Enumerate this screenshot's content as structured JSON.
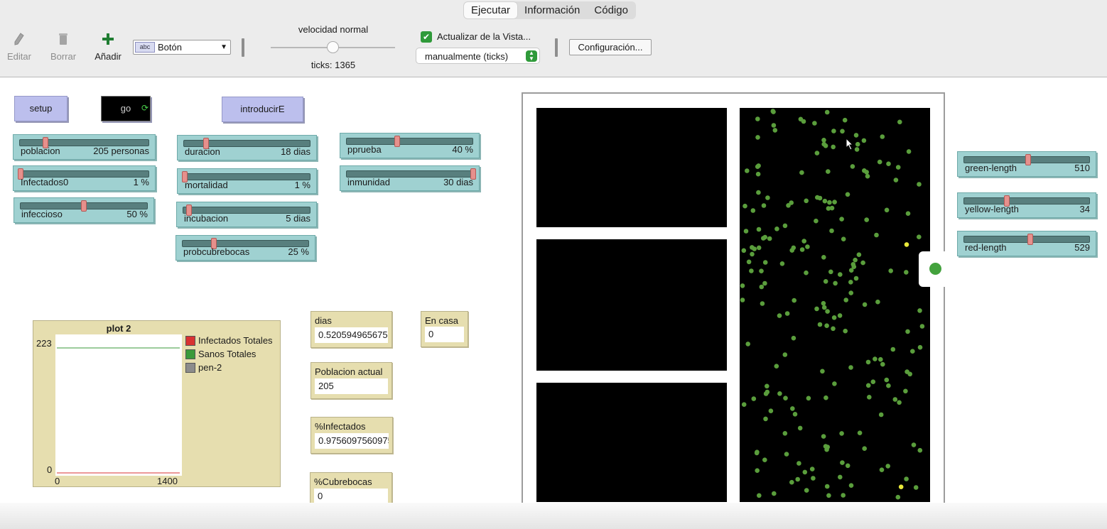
{
  "tabs": [
    "Ejecutar",
    "Información",
    "Código"
  ],
  "toolbar": {
    "edit_label": "Editar",
    "delete_label": "Borrar",
    "add_label": "Añadir",
    "widget_select": "Botón",
    "widget_select_icon_text": "abc",
    "speed_label": "velocidad normal",
    "speed_value": 0.5,
    "ticks": "ticks: 1365",
    "update_view_label": "Actualizar de la Vista...",
    "update_view_checked": true,
    "update_mode": "manualmente (ticks)",
    "settings_button": "Configuración..."
  },
  "buttons": {
    "setup": "setup",
    "go": "go",
    "introducir": "introducirE"
  },
  "sliders": {
    "poblacion": {
      "name": "poblacion",
      "value": "205 personas",
      "fraction": 0.2
    },
    "infectados0": {
      "name": "Infectados0",
      "value": "1 %",
      "fraction": 0.01
    },
    "infeccioso": {
      "name": "infeccioso",
      "value": "50 %",
      "fraction": 0.5
    },
    "duracion": {
      "name": "duracion",
      "value": "18 dias",
      "fraction": 0.18
    },
    "mortalidad": {
      "name": "mortalidad",
      "value": "1 %",
      "fraction": 0.01
    },
    "incubacion": {
      "name": "incubacion",
      "value": "5 dias",
      "fraction": 0.05
    },
    "probcubrebocas": {
      "name": "probcubrebocas",
      "value": "25 %",
      "fraction": 0.25
    },
    "pprueba": {
      "name": "pprueba",
      "value": "40 %",
      "fraction": 0.4
    },
    "inmunidad": {
      "name": "inmunidad",
      "value": "30 dias",
      "fraction": 1.0
    },
    "green_length": {
      "name": "green-length",
      "value": "510",
      "fraction": 0.51
    },
    "yellow_length": {
      "name": "yellow-length",
      "value": "34",
      "fraction": 0.34
    },
    "red_length": {
      "name": "red-length",
      "value": "529",
      "fraction": 0.53
    }
  },
  "monitors": {
    "dias": {
      "label": "dias",
      "value": "0.5205949656750"
    },
    "poblacion_actual": {
      "label": "Poblacion actual",
      "value": "205"
    },
    "infectados_pct": {
      "label": "%Infectados",
      "value": "0.9756097560975"
    },
    "cubrebocas_pct": {
      "label": "%Cubrebocas",
      "value": "0"
    },
    "en_casa": {
      "label": "En casa",
      "value": "0"
    }
  },
  "plot": {
    "title": "plot 2",
    "ymax": "223",
    "ymin": "0",
    "xmin": "0",
    "xmax": "1400",
    "legend": [
      {
        "name": "Infectados Totales",
        "color": "#d83232"
      },
      {
        "name": "Sanos Totales",
        "color": "#3a9a3a"
      },
      {
        "name": "pen-2",
        "color": "#8c8c8c"
      }
    ]
  },
  "colors": {
    "agent": "#5a9e3c",
    "agent_infected": "#e8e83a",
    "slider": "#9fd1d1",
    "button": "#bcbfed",
    "monitor": "#e6deaf"
  }
}
